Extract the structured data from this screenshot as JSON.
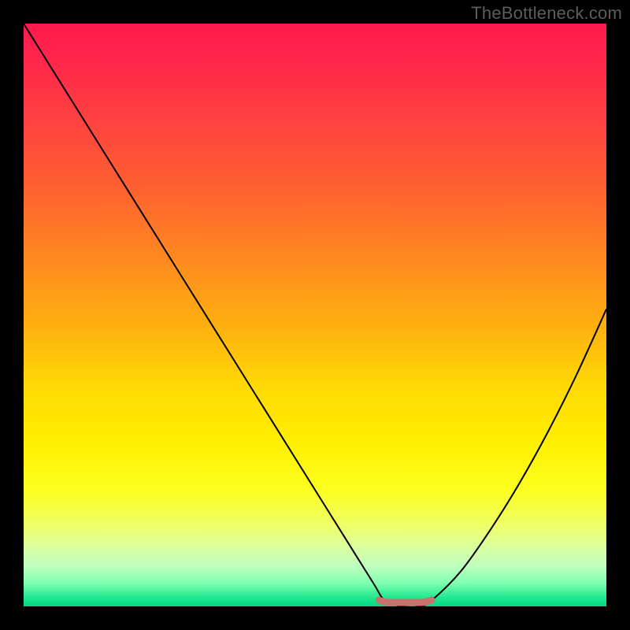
{
  "watermark": "TheBottleneck.com",
  "colors": {
    "frame": "#000000",
    "gradient_top": "#ff1a4d",
    "gradient_mid": "#fff000",
    "gradient_bottom": "#00d880",
    "curve": "#000000",
    "marker": "#c6746b"
  },
  "chart_data": {
    "type": "line",
    "title": "",
    "xlabel": "",
    "ylabel": "",
    "xlim": [
      0,
      100
    ],
    "ylim": [
      0,
      100
    ],
    "series": [
      {
        "name": "bottleneck-curve",
        "x": [
          0,
          5,
          10,
          15,
          20,
          25,
          30,
          35,
          40,
          45,
          50,
          55,
          60,
          62,
          65,
          68,
          70,
          75,
          80,
          85,
          90,
          95,
          100
        ],
        "y": [
          100,
          92,
          84,
          76,
          68,
          60,
          52,
          44,
          36,
          28,
          20,
          12,
          4,
          1,
          0,
          0,
          1,
          6,
          13,
          21,
          30,
          40,
          51
        ]
      }
    ],
    "marker": {
      "x_start": 61,
      "x_end": 70,
      "y": 0
    }
  }
}
